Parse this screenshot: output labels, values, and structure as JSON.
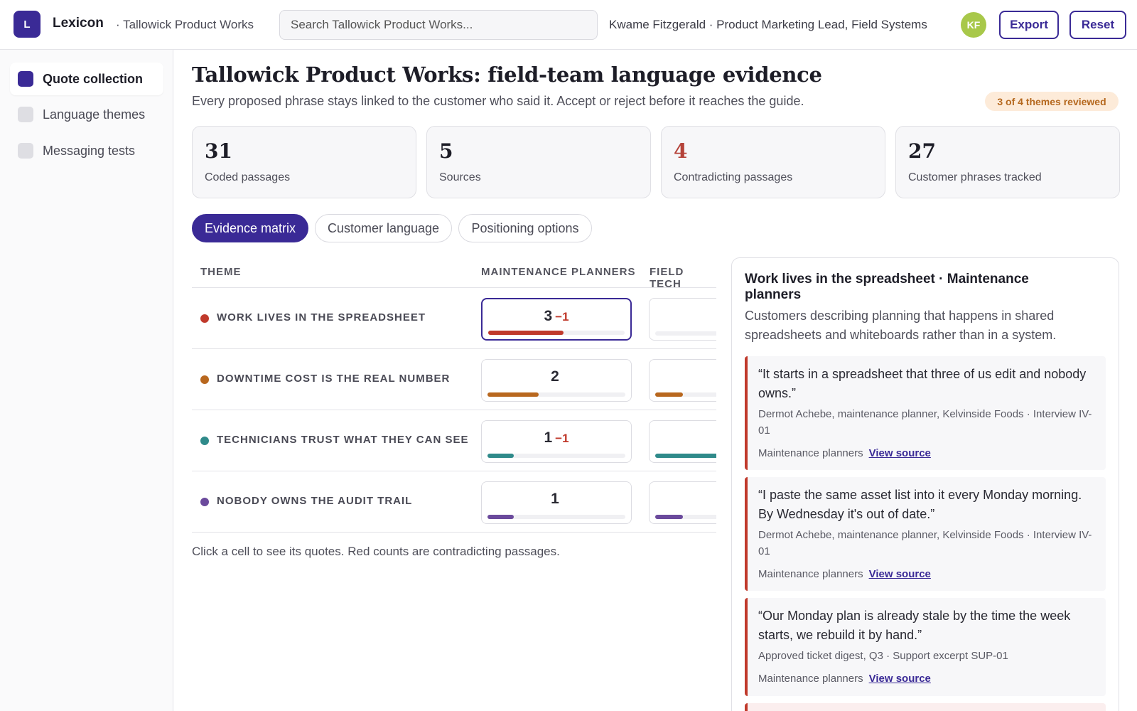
{
  "app": {
    "logo_letter": "L",
    "name": "Lexicon",
    "breadcrumb": "· Tallowick Product Works",
    "search_placeholder": "Search Tallowick Product Works...",
    "user": "Kwame Fitzgerald · Product Marketing Lead, Field Systems",
    "avatar_initials": "KF",
    "export_label": "Export",
    "reset_label": "Reset"
  },
  "sidebar": {
    "items": [
      {
        "label": "Quote collection",
        "active": true
      },
      {
        "label": "Language themes",
        "active": false
      },
      {
        "label": "Messaging tests",
        "active": false
      }
    ]
  },
  "page": {
    "title": "Tallowick Product Works: field-team language evidence",
    "subtitle": "Every proposed phrase stays linked to the customer who said it. Accept or reject before it reaches the guide.",
    "badge": "3 of 4 themes reviewed"
  },
  "stats": [
    {
      "value": "31",
      "label": "Coded passages",
      "color": "#1d1d27"
    },
    {
      "value": "5",
      "label": "Sources",
      "color": "#1d1d27"
    },
    {
      "value": "4",
      "label": "Contradicting passages",
      "color": "#b5433a"
    },
    {
      "value": "27",
      "label": "Customer phrases tracked",
      "color": "#1d1d27"
    }
  ],
  "tabs": [
    "Evidence matrix",
    "Customer language",
    "Positioning options"
  ],
  "matrix": {
    "headers": [
      "THEME",
      "MAINTENANCE PLANNERS",
      "FIELD TECH"
    ],
    "rows": [
      {
        "theme": "WORK LIVES IN THE SPREADSHEET",
        "color": "#c0392b",
        "cells": [
          {
            "count": "3",
            "neg": "−1",
            "fill": 0.55,
            "selected": true
          },
          {
            "count": "0",
            "neg": "",
            "fill": 0
          }
        ]
      },
      {
        "theme": "DOWNTIME COST IS THE REAL NUMBER",
        "color": "#b8671e",
        "cells": [
          {
            "count": "2",
            "neg": "",
            "fill": 0.37
          },
          {
            "count": "1",
            "neg": "",
            "fill": 0.2
          }
        ]
      },
      {
        "theme": "TECHNICIANS TRUST WHAT THEY CAN SEE",
        "color": "#2f8a8a",
        "cells": [
          {
            "count": "1",
            "neg": "−1",
            "fill": 0.19
          },
          {
            "count": "5",
            "neg": "",
            "fill": 0.95
          }
        ]
      },
      {
        "theme": "NOBODY OWNS THE AUDIT TRAIL",
        "color": "#6b4a9c",
        "cells": [
          {
            "count": "1",
            "neg": "",
            "fill": 0.19
          },
          {
            "count": "1",
            "neg": "",
            "fill": 0.2
          }
        ]
      }
    ],
    "hint": "Click a cell to see its quotes. Red counts are contradicting passages."
  },
  "panel": {
    "title": "Work lives in the spreadsheet · Maintenance planners",
    "description": "Customers describing planning that happens in shared spreadsheets and whiteboards rather than in a system.",
    "view_source_label": "View source",
    "quotes": [
      {
        "text": "“It starts in a spreadsheet that three of us edit and nobody owns.”",
        "source": "Dermot Achebe, maintenance planner, Kelvinside Foods · Interview IV-01",
        "segment": "Maintenance planners"
      },
      {
        "text": "“I paste the same asset list into it every Monday morning. By Wednesday it's out of date.”",
        "source": "Dermot Achebe, maintenance planner, Kelvinside Foods · Interview IV-01",
        "segment": "Maintenance planners"
      },
      {
        "text": "“Our Monday plan is already stale by the time the week starts, we rebuild it by hand.”",
        "source": "Approved ticket digest, Q3 · Support excerpt SUP-01",
        "segment": "Maintenance planners"
      }
    ]
  }
}
